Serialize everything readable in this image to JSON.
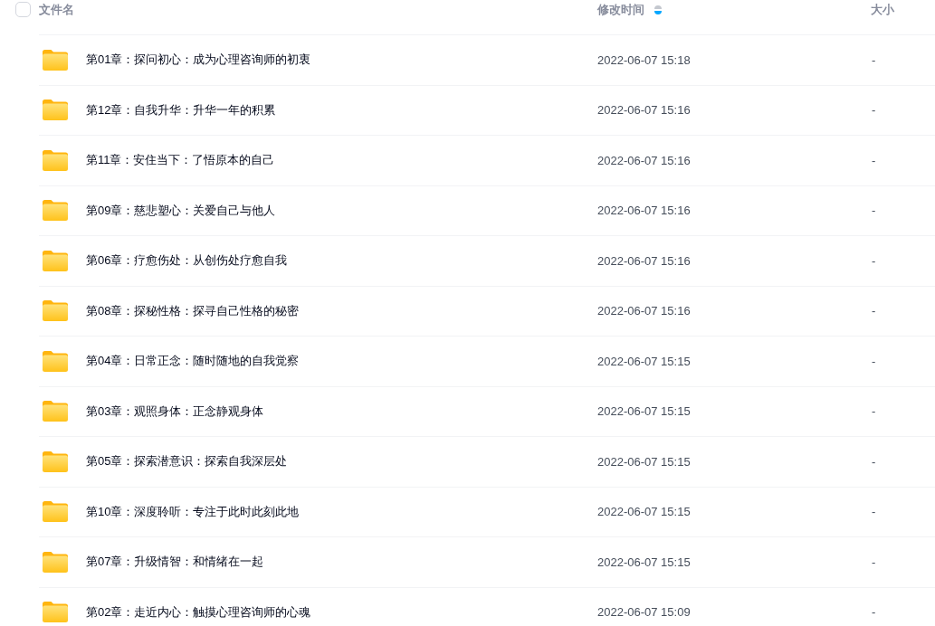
{
  "header": {
    "select_all": {
      "checked": false
    },
    "columns": [
      {
        "label": "文件名",
        "sorted": false
      },
      {
        "label": "修改时间",
        "sorted": true,
        "descending": true
      },
      {
        "label": "大小",
        "sorted": false
      }
    ]
  },
  "files": [
    {
      "name": "第01章：探问初心：成为心理咨询师的初衷",
      "modified": "2022-06-07 15:18",
      "size": "-"
    },
    {
      "name": "第12章：自我升华：升华一年的积累",
      "modified": "2022-06-07 15:16",
      "size": "-"
    },
    {
      "name": "第11章：安住当下：了悟原本的自己",
      "modified": "2022-06-07 15:16",
      "size": "-"
    },
    {
      "name": "第09章：慈悲塑心：关爱自己与他人",
      "modified": "2022-06-07 15:16",
      "size": "-"
    },
    {
      "name": "第06章：疗愈伤处：从创伤处疗愈自我",
      "modified": "2022-06-07 15:16",
      "size": "-"
    },
    {
      "name": "第08章：探秘性格：探寻自己性格的秘密",
      "modified": "2022-06-07 15:16",
      "size": "-"
    },
    {
      "name": "第04章：日常正念：随时随地的自我觉察",
      "modified": "2022-06-07 15:15",
      "size": "-"
    },
    {
      "name": "第03章：观照身体：正念静观身体",
      "modified": "2022-06-07 15:15",
      "size": "-"
    },
    {
      "name": "第05章：探索潜意识：探索自我深层处",
      "modified": "2022-06-07 15:15",
      "size": "-"
    },
    {
      "name": "第10章：深度聆听：专注于此时此刻此地",
      "modified": "2022-06-07 15:15",
      "size": "-"
    },
    {
      "name": "第07章：升级情智：和情绪在一起",
      "modified": "2022-06-07 15:15",
      "size": "-"
    },
    {
      "name": "第02章：走近内心：触摸心理咨询师的心魂",
      "modified": "2022-06-07 15:09",
      "size": "-"
    }
  ]
}
